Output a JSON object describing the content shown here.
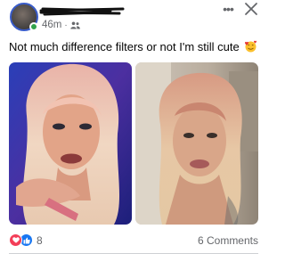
{
  "post": {
    "timestamp": "46m",
    "separator": "·",
    "audience_icon": "friends-icon",
    "text": "Not much difference filters or not I'm still cute",
    "text_emoji": "smiling-face-with-hearts-emoji"
  },
  "header_actions": {
    "more_label": "•••",
    "more_icon": "more-horizontal-icon",
    "close_icon": "close-icon"
  },
  "photos": [
    {
      "name": "photo-filtered",
      "icon": "photo"
    },
    {
      "name": "photo-unfiltered",
      "icon": "photo"
    }
  ],
  "engagement": {
    "reaction_icons": [
      "love-reaction-icon",
      "like-reaction-icon"
    ],
    "reaction_count": "8",
    "comments_label": "6 Comments"
  },
  "colors": {
    "link_blue": "#1877f2",
    "love_red": "#f33e58",
    "online_green": "#31a24c",
    "secondary_text": "#65676b"
  }
}
